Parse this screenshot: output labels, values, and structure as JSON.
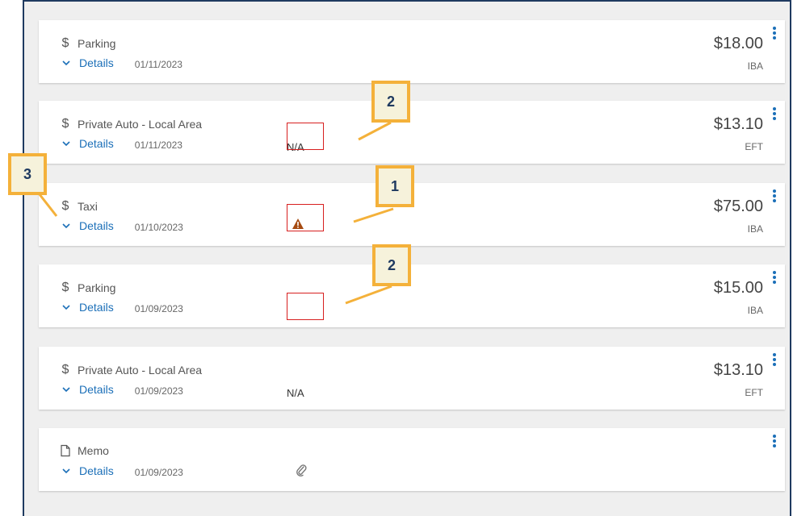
{
  "expenses": [
    {
      "icon": "$",
      "title": "Parking",
      "details_label": "Details",
      "date": "01/11/2023",
      "status": "",
      "amount": "$18.00",
      "payment": "IBA"
    },
    {
      "icon": "$",
      "title": "Private Auto - Local Area",
      "details_label": "Details",
      "date": "01/11/2023",
      "status": "N/A",
      "amount": "$13.10",
      "payment": "EFT"
    },
    {
      "icon": "$",
      "title": "Taxi",
      "details_label": "Details",
      "date": "01/10/2023",
      "status": "",
      "amount": "$75.00",
      "payment": "IBA"
    },
    {
      "icon": "$",
      "title": "Parking",
      "details_label": "Details",
      "date": "01/09/2023",
      "status": "",
      "amount": "$15.00",
      "payment": "IBA"
    },
    {
      "icon": "$",
      "title": "Private Auto - Local Area",
      "details_label": "Details",
      "date": "01/09/2023",
      "status": "N/A",
      "amount": "$13.10",
      "payment": "EFT"
    },
    {
      "icon": "memo",
      "title": "Memo",
      "details_label": "Details",
      "date": "01/09/2023",
      "status": "",
      "amount": "",
      "payment": ""
    }
  ],
  "callouts": {
    "c1": "2",
    "c2": "3",
    "c3": "1",
    "c4": "2"
  },
  "icons": {
    "warning": "warning-triangle-icon",
    "attachment": "paperclip-icon",
    "memo": "document-icon",
    "more": "kebab-menu-icon",
    "expand": "chevron-down-icon"
  },
  "colors": {
    "link": "#1b6fb8",
    "callout_border": "#f4b13a",
    "callout_text": "#1f3a60",
    "highlight_box": "#d71f1f",
    "warning": "#a64b12"
  }
}
